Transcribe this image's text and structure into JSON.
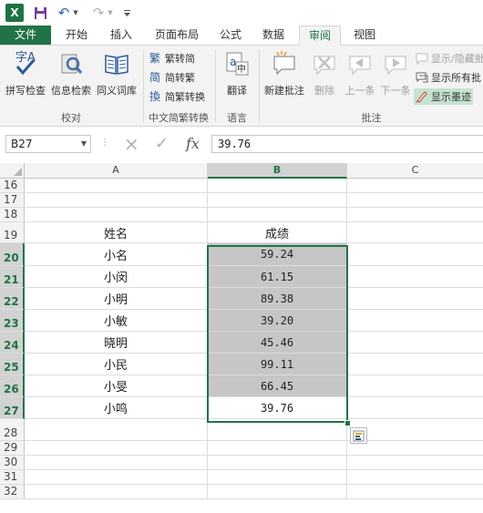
{
  "titlebar": {
    "app_icon_letter": "X",
    "icons": [
      "excel-logo",
      "save-icon",
      "undo-icon",
      "redo-icon",
      "customize-qat-icon"
    ]
  },
  "tabs": [
    "文件",
    "开始",
    "插入",
    "页面布局",
    "公式",
    "数据",
    "审阅",
    "视图"
  ],
  "active_tab": "审阅",
  "ribbon": {
    "proofing": {
      "group_label": "校对",
      "buttons": [
        "拼写检查",
        "信息检索",
        "同义词库"
      ]
    },
    "chinese_conversion": {
      "group_label": "中文简繁转换",
      "buttons": [
        "繁转简",
        "简转繁",
        "简繁转换"
      ]
    },
    "language": {
      "group_label": "语言",
      "buttons": [
        "翻译"
      ]
    },
    "comments": {
      "group_label": "批注",
      "buttons": [
        "新建批注",
        "删除",
        "上一条",
        "下一条"
      ],
      "small_buttons": [
        "显示/隐藏批",
        "显示所有批",
        "显示墨迹"
      ]
    }
  },
  "formula_bar": {
    "name_box": "B27",
    "cancel_icon": "×",
    "enter_icon": "✓",
    "fx_label": "fx",
    "value": "39.76"
  },
  "columns": [
    "A",
    "B",
    "C"
  ],
  "selected_column": "B",
  "rows": [
    {
      "num": "16",
      "a": "",
      "b": ""
    },
    {
      "num": "17",
      "a": "",
      "b": ""
    },
    {
      "num": "18",
      "a": "",
      "b": ""
    },
    {
      "num": "19",
      "a": "姓名",
      "b": "成绩"
    },
    {
      "num": "20",
      "a": "小名",
      "b": "59.24"
    },
    {
      "num": "21",
      "a": "小闵",
      "b": "61.15"
    },
    {
      "num": "22",
      "a": "小明",
      "b": "89.38"
    },
    {
      "num": "23",
      "a": "小敏",
      "b": "39.20"
    },
    {
      "num": "24",
      "a": "晓明",
      "b": "45.46"
    },
    {
      "num": "25",
      "a": "小民",
      "b": "99.11"
    },
    {
      "num": "26",
      "a": "小旻",
      "b": "66.45"
    },
    {
      "num": "27",
      "a": "小鸣",
      "b": "39.76"
    },
    {
      "num": "28",
      "a": "",
      "b": ""
    },
    {
      "num": "29",
      "a": "",
      "b": ""
    },
    {
      "num": "30",
      "a": "",
      "b": ""
    },
    {
      "num": "31",
      "a": "",
      "b": ""
    },
    {
      "num": "32",
      "a": "",
      "b": ""
    }
  ],
  "selected_rows": [
    "20",
    "21",
    "22",
    "23",
    "24",
    "25",
    "26",
    "27"
  ],
  "colors": {
    "excel_green": "#217346",
    "selection_fill": "#c6c6c6",
    "header_bg": "#f3f3f3"
  }
}
